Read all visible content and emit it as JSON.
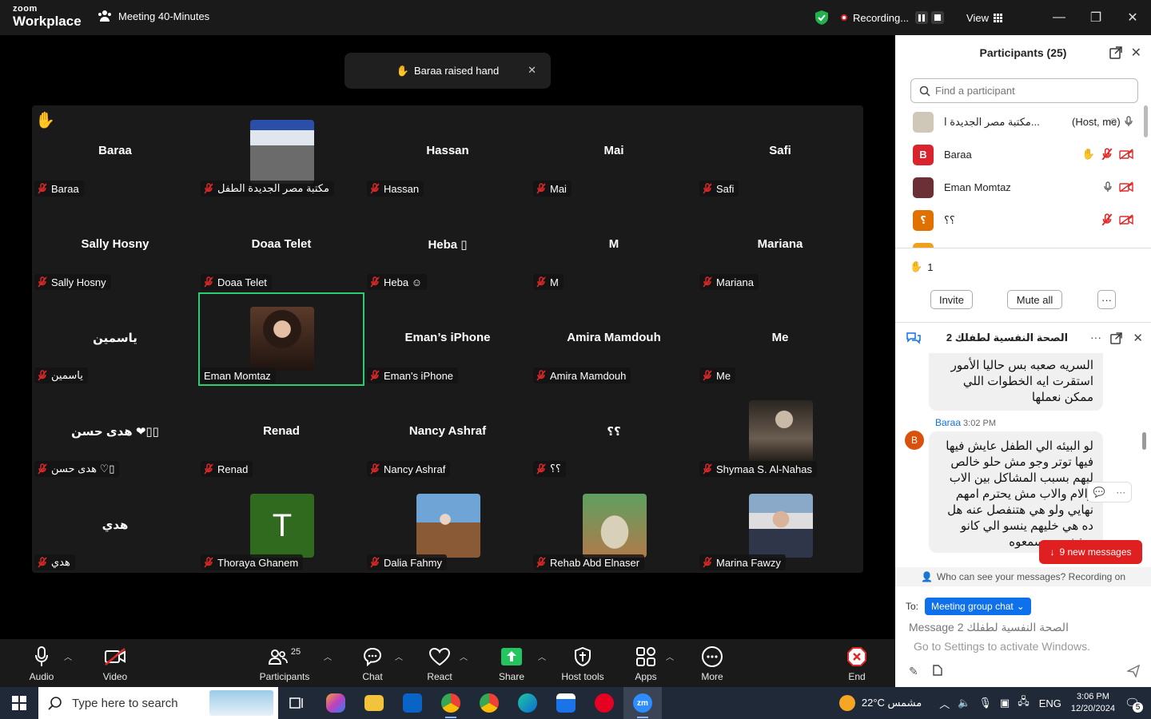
{
  "titlebar": {
    "logo_line1": "zoom",
    "logo_line2": "Workplace",
    "meeting_title": "Meeting 40-Minutes",
    "recording": "Recording...",
    "view": "View"
  },
  "toast": {
    "text": "Baraa raised hand"
  },
  "gallery": {
    "tiles": [
      {
        "big": "Baraa",
        "label": "Baraa",
        "hand": true
      },
      {
        "big": "",
        "label": "مكتبة مصر الجديدة الطفل",
        "photo": "library-photo"
      },
      {
        "big": "Hassan",
        "label": "Hassan"
      },
      {
        "big": "Mai",
        "label": "Mai"
      },
      {
        "big": "Safi",
        "label": "Safi"
      },
      {
        "big": "Sally Hosny",
        "label": "Sally Hosny"
      },
      {
        "big": "Doaa Telet",
        "label": "Doaa Telet"
      },
      {
        "big": "Heba ▯",
        "label": "Heba ☺"
      },
      {
        "big": "M",
        "label": "M"
      },
      {
        "big": "Mariana",
        "label": "Mariana"
      },
      {
        "big": "ياسمين",
        "label": "ياسمين"
      },
      {
        "big": "",
        "label": "Eman Momtaz",
        "photo": "eman-photo",
        "active": true,
        "nomic": true
      },
      {
        "big": "Eman’s iPhone",
        "label": "Eman's iPhone"
      },
      {
        "big": "Amira Mamdouh",
        "label": "Amira Mamdouh"
      },
      {
        "big": "Me",
        "label": "Me"
      },
      {
        "big": "هدى حسن ❤▯▯",
        "label": "هدى حسن ♡▯"
      },
      {
        "big": "Renad",
        "label": "Renad"
      },
      {
        "big": "Nancy Ashraf",
        "label": "Nancy Ashraf"
      },
      {
        "big": "؟؟",
        "label": "؟؟"
      },
      {
        "big": "",
        "label": "Shymaa S. Al-Nahas",
        "photo": "shymaa-photo"
      },
      {
        "big": "هدي",
        "label": "هدي"
      },
      {
        "big": "",
        "label": "Thoraya Ghanem",
        "photo": "thoraya-avatar",
        "letter": "T"
      },
      {
        "big": "",
        "label": "Dalia Fahmy",
        "photo": "dalia-photo"
      },
      {
        "big": "",
        "label": "Rehab Abd Elnaser",
        "photo": "rehab-photo"
      },
      {
        "big": "",
        "label": "Marina Fawzy",
        "photo": "marina-photo"
      }
    ]
  },
  "toolbar": {
    "audio": "Audio",
    "video": "Video",
    "participants": "Participants",
    "participants_count": "25",
    "chat": "Chat",
    "react": "React",
    "share": "Share",
    "host_tools": "Host tools",
    "apps": "Apps",
    "more": "More",
    "end": "End"
  },
  "participants_panel": {
    "title": "Participants (25)",
    "search_placeholder": "Find a participant",
    "rows": [
      {
        "name": "مكتبة مصر الجديدة ا...",
        "suffix": "(Host, me)",
        "avatar": "",
        "color": "#cfc7b8"
      },
      {
        "name": "Baraa",
        "suffix": "",
        "avatar": "B",
        "color": "#d9232d"
      },
      {
        "name": "Eman Momtaz",
        "suffix": "",
        "avatar": "",
        "color": "#6b2f36"
      },
      {
        "name": "؟؟",
        "suffix": "",
        "avatar": "؟",
        "color": "#e07000"
      }
    ],
    "hands_count": "1",
    "invite": "Invite",
    "mute_all": "Mute all"
  },
  "chat_panel": {
    "title": "الصحة النفسية لطفلك 2",
    "msg1": [
      "السريه صعبه بس حاليا الأمور",
      "استقرت ايه الخطوات اللي",
      "ممكن نعملها"
    ],
    "sender": "Baraa",
    "time": "3:02 PM",
    "sender_initial": "B",
    "msg2": [
      "لو البيئه الي الطفل عايش فيها",
      "فيها توتر وجو مش حلو خالص",
      "ليهم بسبب المشاكل بين الاب",
      "والام والاب مش يحترم امهم",
      "نهايي ولو هي هتنفصل عنه هل",
      "ده هي خليهم ينسو الي كانو",
      "بيشفوه ويسمعوه"
    ],
    "new_messages": "9 new messages",
    "who_can_see": "Who can see your messages? Recording on",
    "to_label": "To:",
    "to_value": "Meeting group chat",
    "input_placeholder": "Message الصحة النفسية لطفلك 2",
    "activate_windows": "Go to Settings to activate Windows."
  },
  "taskbar": {
    "search_placeholder": "Type here to search",
    "weather": "22°C  مشمس",
    "lang": "ENG",
    "time": "3:06 PM",
    "date": "12/20/2024",
    "notifications": "5"
  }
}
